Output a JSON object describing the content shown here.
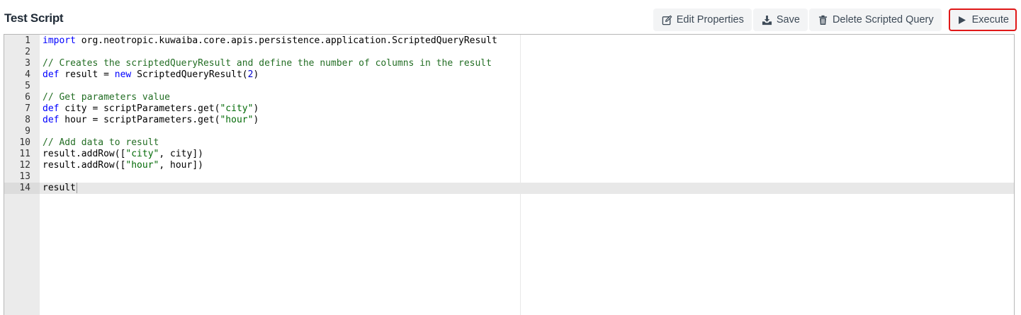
{
  "page": {
    "title": "Test Script"
  },
  "toolbar": {
    "edit_properties_label": "Edit Properties",
    "save_label": "Save",
    "delete_label": "Delete Scripted Query",
    "execute_label": "Execute"
  },
  "editor": {
    "lines": [
      {
        "n": "1",
        "tokens": [
          {
            "t": "kw",
            "v": "import"
          },
          {
            "t": "pl",
            "v": " org.neotropic.kuwaiba.core.apis.persistence.application.ScriptedQueryResult"
          }
        ]
      },
      {
        "n": "2",
        "tokens": []
      },
      {
        "n": "3",
        "tokens": [
          {
            "t": "cm",
            "v": "// Creates the scriptedQueryResult and define the number of columns in the result"
          }
        ]
      },
      {
        "n": "4",
        "tokens": [
          {
            "t": "kw",
            "v": "def"
          },
          {
            "t": "pl",
            "v": " result = "
          },
          {
            "t": "kw",
            "v": "new"
          },
          {
            "t": "pl",
            "v": " ScriptedQueryResult("
          },
          {
            "t": "num",
            "v": "2"
          },
          {
            "t": "pl",
            "v": ")"
          }
        ]
      },
      {
        "n": "5",
        "tokens": []
      },
      {
        "n": "6",
        "tokens": [
          {
            "t": "cm",
            "v": "// Get parameters value"
          }
        ]
      },
      {
        "n": "7",
        "tokens": [
          {
            "t": "kw",
            "v": "def"
          },
          {
            "t": "pl",
            "v": " city = scriptParameters.get("
          },
          {
            "t": "str",
            "v": "\"city\""
          },
          {
            "t": "pl",
            "v": ")"
          }
        ]
      },
      {
        "n": "8",
        "tokens": [
          {
            "t": "kw",
            "v": "def"
          },
          {
            "t": "pl",
            "v": " hour = scriptParameters.get("
          },
          {
            "t": "str",
            "v": "\"hour\""
          },
          {
            "t": "pl",
            "v": ")"
          }
        ]
      },
      {
        "n": "9",
        "tokens": []
      },
      {
        "n": "10",
        "tokens": [
          {
            "t": "cm",
            "v": "// Add data to result"
          }
        ]
      },
      {
        "n": "11",
        "tokens": [
          {
            "t": "pl",
            "v": "result.addRow(["
          },
          {
            "t": "str",
            "v": "\"city\""
          },
          {
            "t": "pl",
            "v": ", city])"
          }
        ]
      },
      {
        "n": "12",
        "tokens": [
          {
            "t": "pl",
            "v": "result.addRow(["
          },
          {
            "t": "str",
            "v": "\"hour\""
          },
          {
            "t": "pl",
            "v": ", hour])"
          }
        ]
      },
      {
        "n": "13",
        "tokens": []
      },
      {
        "n": "14",
        "tokens": [
          {
            "t": "pl",
            "v": "result"
          }
        ],
        "active": true
      }
    ]
  },
  "icons": {
    "edit_properties": "edit-icon",
    "save": "download-icon",
    "delete": "trash-icon",
    "execute": "play-icon"
  },
  "colors": {
    "execute_highlight": "#e01818",
    "keyword": "#0000ff",
    "comment": "#236e24",
    "string": "#036a07"
  }
}
